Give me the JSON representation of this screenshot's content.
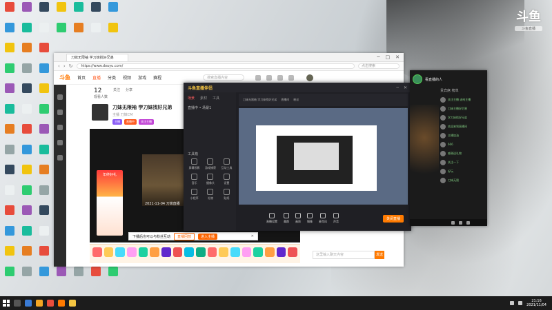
{
  "watermark": {
    "big": "斗鱼",
    "small": "斗鱼直播"
  },
  "browser": {
    "tab_title": "刀妹无限袖 学刀妹找好兄弟",
    "url": "https://www.douyu.com/",
    "search_placeholder": "点击搜索",
    "controls": [
      "─",
      "□",
      "✕"
    ]
  },
  "site": {
    "logo": "斗鱼",
    "nav": [
      "首页",
      "直播",
      "分类",
      "视频",
      "游戏",
      "赛程"
    ],
    "active_nav": 1,
    "search_placeholder": "搜索直播内容"
  },
  "room": {
    "stats": [
      {
        "num": "12",
        "label": "观看人数"
      },
      {
        "num": "",
        "label": "关注"
      },
      {
        "num": "",
        "label": "分享"
      }
    ],
    "title": "刀妹无限袖 学刀妹找好兄弟",
    "meta": "主播 刀妹CM",
    "badges": [
      "主播",
      "直播中",
      "关注主播"
    ],
    "player_caption": "2021-11-04 刀妹直播",
    "promo_text": "年终好礼"
  },
  "toast": {
    "text": "下播后也可以与粉丝互动",
    "btn_a": "直播回放",
    "btn_b": "进入主播",
    "close": "✕"
  },
  "chat_input_placeholder": "这里输入聊天内容",
  "send_label": "发送",
  "streamapp": {
    "logo": "斗鱼直播伴侣",
    "title": "刀妹无限袖 学刀妹找好兄弟",
    "tabs": [
      "场景",
      "素材",
      "工具"
    ],
    "scene": "直播中 • 场景1",
    "tools_title": "工具箱",
    "tools": [
      "屏幕投影",
      "游戏捕获",
      "互动工具",
      "音乐",
      "摄像头",
      "设置",
      "小程序",
      "礼物",
      "贴纸"
    ],
    "preview_header": [
      "刀妹无限袖 学刀妹找好兄弟",
      "直播间",
      "粉丝"
    ],
    "bottom_buttons": [
      "直播设置",
      "美颜",
      "画质",
      "镜像",
      "麦克风",
      "声音"
    ],
    "golive": "关闭直播"
  },
  "chatpanel": {
    "name": "看直播的人",
    "tab": "贵宾席 榜单",
    "messages": [
      "关注主播 送给主播",
      "刀妹主播好厉害",
      "学刀妹找好兄弟",
      "欢迎来到直播间",
      "主播加油",
      "666",
      "感谢送礼物",
      "关注一下",
      "好玩",
      "刀妹无限"
    ]
  },
  "taskbar": {
    "time": "21:16",
    "date": "2021/11/04"
  }
}
